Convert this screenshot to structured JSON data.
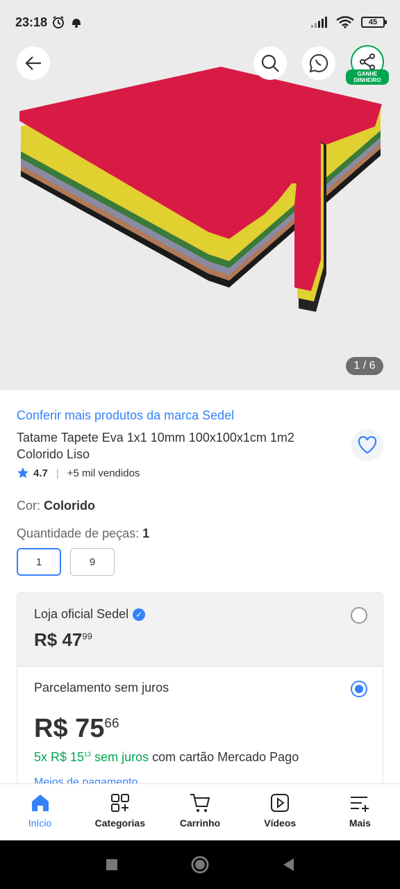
{
  "status_bar": {
    "time": "23:18",
    "battery": "45"
  },
  "gallery": {
    "counter": "1 / 6",
    "earn_badge": "GANHE DINHEIRO"
  },
  "product": {
    "brand_link": "Conferir mais produtos da marca Sedel",
    "title": "Tatame Tapete Eva 1x1 10mm 100x100x1cm 1m2 Colorido Liso",
    "rating": "4.7",
    "sold": "+5 mil vendidos"
  },
  "variations": {
    "color_label": "Cor:",
    "color_value": "Colorido",
    "qty_label": "Quantidade de peças:",
    "qty_value": "1",
    "qty_options": [
      "1",
      "9"
    ]
  },
  "offers": {
    "store": "Loja oficial Sedel",
    "price1_int": "R$ 47",
    "price1_cents": "99",
    "installment_title": "Parcelamento sem juros",
    "price2_int": "R$ 75",
    "price2_cents": "66",
    "install_green_prefix": "5x R$ 15",
    "install_green_cents": "13",
    "install_green_suffix": " sem juros",
    "install_rest": " com cartão Mercado Pago",
    "payment_link": "Meios de pagamento"
  },
  "bottom_nav": [
    {
      "label": "Início",
      "icon": "home-icon"
    },
    {
      "label": "Categorias",
      "icon": "categories-icon"
    },
    {
      "label": "Carrinho",
      "icon": "cart-icon"
    },
    {
      "label": "Vídeos",
      "icon": "video-icon"
    },
    {
      "label": "Mais",
      "icon": "menu-plus-icon"
    }
  ],
  "colors": {
    "accent": "#3483fa",
    "green": "#00a650",
    "mat_top": "#d81b45"
  }
}
